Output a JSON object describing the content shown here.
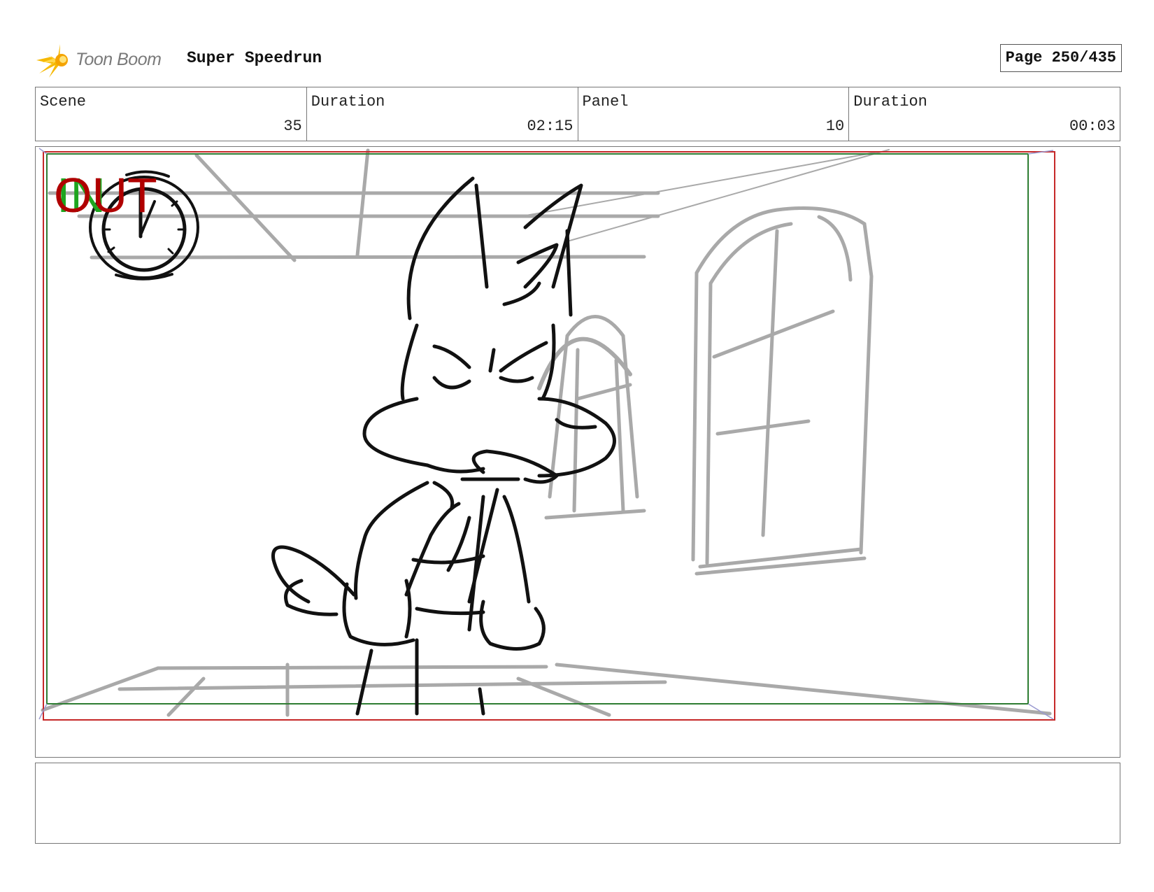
{
  "header": {
    "logo_text": "Toon Boom",
    "project_title": "Super Speedrun",
    "page_label": "Page 250/435"
  },
  "info": {
    "scene_label": "Scene",
    "scene_value": "35",
    "scene_duration_label": "Duration",
    "scene_duration_value": "02:15",
    "panel_label": "Panel",
    "panel_value": "10",
    "panel_duration_label": "Duration",
    "panel_duration_value": "00:03"
  },
  "panel": {
    "transition_in_text": "IN",
    "transition_out_text": "OUT",
    "colors": {
      "safe_frame": "#2e7d32",
      "camera_frame": "#c62828",
      "sketch_bg": "#a9a9a9",
      "sketch_ink": "#111111",
      "in_text": "#1fa51f",
      "out_text": "#b00000"
    }
  },
  "notes": {
    "text": ""
  }
}
